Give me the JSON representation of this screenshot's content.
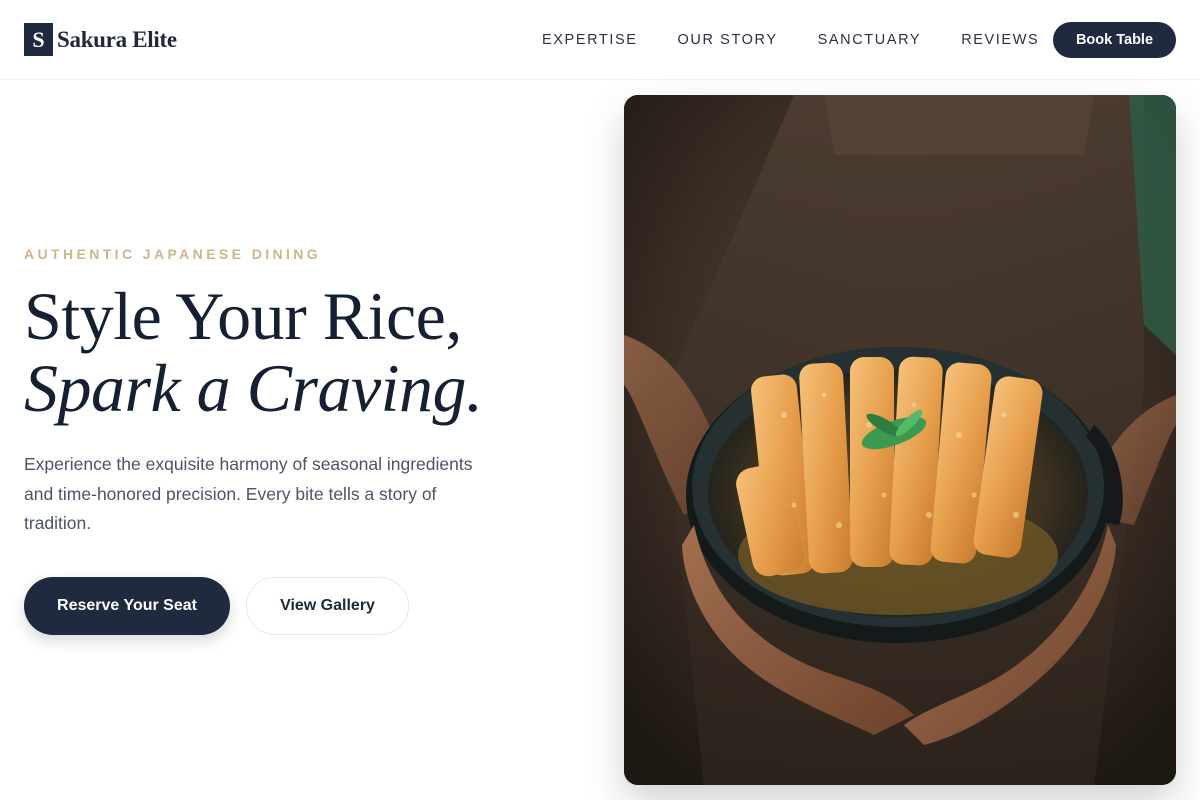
{
  "brand": {
    "mark": "S",
    "name": "Sakura Elite"
  },
  "nav": {
    "items": [
      {
        "label": "EXPERTISE"
      },
      {
        "label": "OUR STORY"
      },
      {
        "label": "SANCTUARY"
      },
      {
        "label": "REVIEWS"
      }
    ],
    "cta_label": "Book Table"
  },
  "hero": {
    "eyebrow": "AUTHENTIC JAPANESE DINING",
    "headline_line1": "Style Your Rice,",
    "headline_line2": "Spark a Craving.",
    "description": "Experience the exquisite harmony of seasonal ingredients and time-honored precision. Every bite tells a story of tradition.",
    "primary_button": "Reserve Your Seat",
    "secondary_button": "View Gallery",
    "image_icon": "katsu-bowl-photo"
  },
  "colors": {
    "navy": "#1f2a40",
    "gold_accent": "#d1b489",
    "body_text": "#4b5567",
    "heading": "#162033"
  }
}
